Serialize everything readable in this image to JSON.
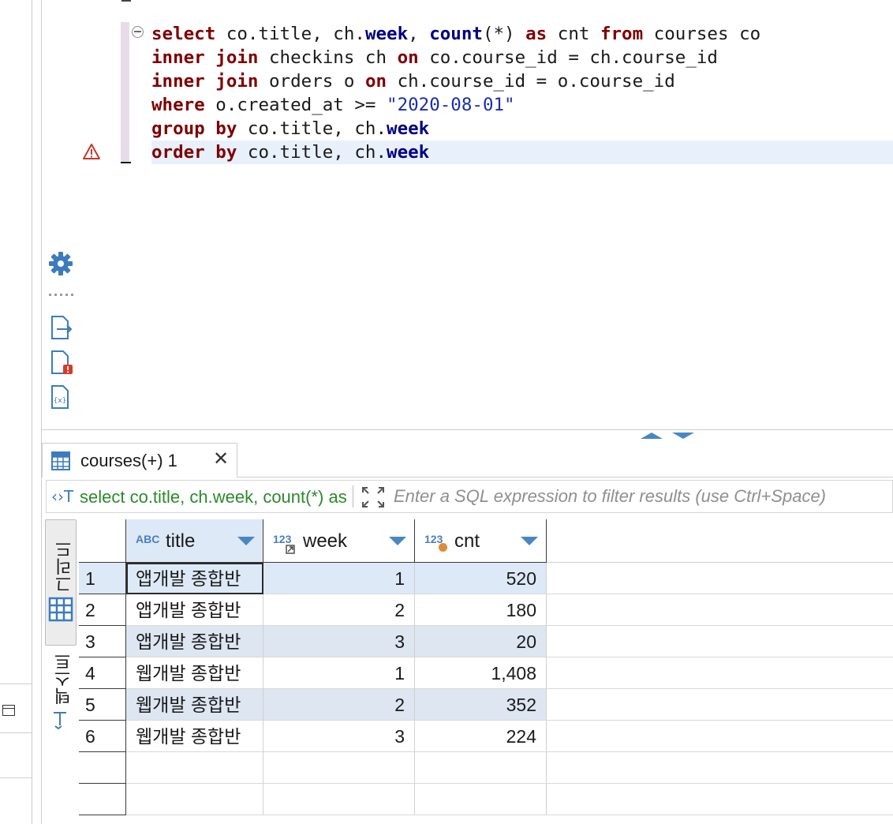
{
  "editor": {
    "lines": [
      [
        [
          "kw",
          "select"
        ],
        [
          "plain",
          " co.title, ch."
        ],
        [
          "fn",
          "week"
        ],
        [
          "plain",
          ", "
        ],
        [
          "fn",
          "count"
        ],
        [
          "plain",
          "(*) "
        ],
        [
          "kw",
          "as"
        ],
        [
          "plain",
          " cnt "
        ],
        [
          "kw",
          "from"
        ],
        [
          "plain",
          " courses co"
        ]
      ],
      [
        [
          "kw",
          "inner join"
        ],
        [
          "plain",
          " checkins ch "
        ],
        [
          "kw",
          "on"
        ],
        [
          "plain",
          " co.course_id = ch.course_id"
        ]
      ],
      [
        [
          "kw",
          "inner join"
        ],
        [
          "plain",
          " orders o "
        ],
        [
          "kw",
          "on"
        ],
        [
          "plain",
          " ch.course_id = o.course_id"
        ]
      ],
      [
        [
          "kw",
          "where"
        ],
        [
          "plain",
          " o.created_at >= "
        ],
        [
          "str",
          "\"2020-08-01\""
        ]
      ],
      [
        [
          "kw",
          "group by"
        ],
        [
          "plain",
          " co.title, ch."
        ],
        [
          "fn",
          "week"
        ]
      ],
      [
        [
          "kw",
          "order by"
        ],
        [
          "plain",
          " co.title, ch."
        ],
        [
          "fn",
          "week"
        ]
      ]
    ],
    "warning_icon": "warning-triangle-icon",
    "current_line_index": 5
  },
  "side_tools": [
    "gear-icon",
    "more-dots-icon",
    "export-file-icon",
    "file-error-icon",
    "file-variables-icon"
  ],
  "results_tab": {
    "label": "courses(+) 1",
    "close_glyph": "✕",
    "icon": "table-grid-icon"
  },
  "filter": {
    "query_preview": "select co.title, ch.week, count(*) as cnt from courses co",
    "query_icon_glyph": "‹›T",
    "placeholder": "Enter a SQL expression to filter results (use Ctrl+Space)"
  },
  "view_tabs": {
    "grid_label": "그리드",
    "text_label": "텍스트"
  },
  "table": {
    "columns": [
      {
        "type": "ABC",
        "name": "title"
      },
      {
        "type": "123",
        "name": "week"
      },
      {
        "type": "123",
        "name": "cnt"
      }
    ],
    "rows": [
      {
        "n": "1",
        "title": "앱개발 종합반",
        "week": "1",
        "cnt": "520"
      },
      {
        "n": "2",
        "title": "앱개발 종합반",
        "week": "2",
        "cnt": "180"
      },
      {
        "n": "3",
        "title": "앱개발 종합반",
        "week": "3",
        "cnt": "20"
      },
      {
        "n": "4",
        "title": "웹개발 종합반",
        "week": "1",
        "cnt": "1,408"
      },
      {
        "n": "5",
        "title": "웹개발 종합반",
        "week": "2",
        "cnt": "352"
      },
      {
        "n": "6",
        "title": "웹개발 종합반",
        "week": "3",
        "cnt": "224"
      }
    ],
    "empty_rows": 2
  },
  "colors": {
    "keyword": "#7f0000",
    "function": "#000080",
    "string": "#1a2fa8",
    "accent": "#4a86c5",
    "selected_row": "#dde9f7"
  }
}
